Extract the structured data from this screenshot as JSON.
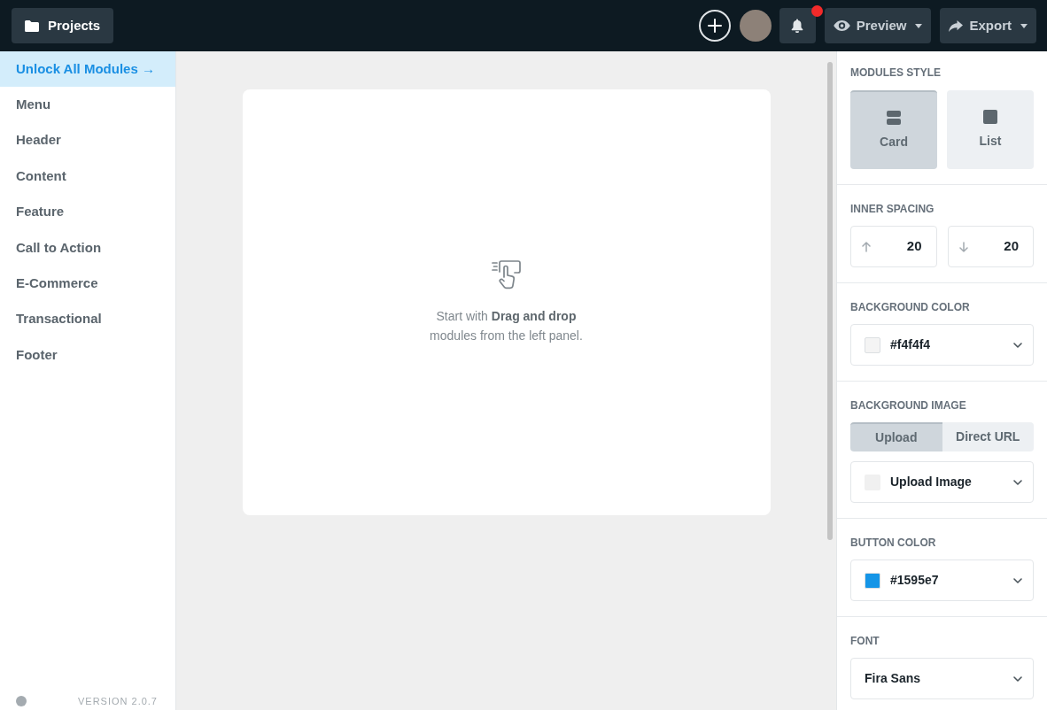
{
  "topbar": {
    "projects_button": "Projects",
    "has_unread_notifications": true,
    "preview_button": "Preview",
    "export_button": "Export"
  },
  "sidebar": {
    "items": [
      {
        "label": "Unlock All Modules →",
        "kind": "promo"
      },
      {
        "label": "Menu",
        "kind": "category"
      },
      {
        "label": "Header",
        "kind": "category"
      },
      {
        "label": "Content",
        "kind": "category"
      },
      {
        "label": "Feature",
        "kind": "category"
      },
      {
        "label": "Call to Action",
        "kind": "category"
      },
      {
        "label": "E-Commerce",
        "kind": "category"
      },
      {
        "label": "Transactional",
        "kind": "category"
      },
      {
        "label": "Footer",
        "kind": "category"
      }
    ],
    "version": "VERSION 2.0.7"
  },
  "canvas": {
    "empty_message": "Start with **Drag and drop** modules from the left panel."
  },
  "settings": {
    "sections": [
      {
        "kind": "options",
        "label": "MODULES STYLE",
        "options": [
          {
            "kind": "card",
            "label": "Card",
            "selected": true
          },
          {
            "kind": "list",
            "label": "List",
            "selected": false
          }
        ]
      },
      {
        "kind": "spacing",
        "label": "INNER SPACING",
        "fields": [
          {
            "kind": "top",
            "value": "20"
          },
          {
            "kind": "bottom",
            "value": "20"
          }
        ]
      },
      {
        "kind": "color_select",
        "label": "BACKGROUND COLOR",
        "value": "#f4f4f4",
        "color": "#f4f4f4"
      },
      {
        "kind": "image_source",
        "label": "BACKGROUND IMAGE",
        "tabs": [
          {
            "label": "Upload",
            "selected": true
          },
          {
            "label": "Direct URL",
            "selected": false
          }
        ],
        "value": "Upload Image"
      },
      {
        "kind": "color_select",
        "label": "BUTTON COLOR",
        "value": "#1595e7",
        "color": "#1595e7"
      },
      {
        "kind": "select",
        "label": "FONT",
        "value": "Fira Sans"
      }
    ]
  }
}
